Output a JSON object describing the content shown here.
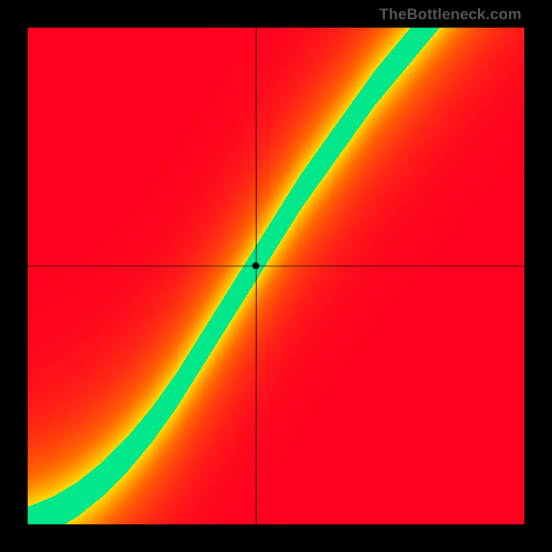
{
  "watermark": "TheBottleneck.com",
  "chart_data": {
    "type": "heatmap",
    "title": "",
    "xlabel": "",
    "ylabel": "",
    "xlim": [
      0,
      1
    ],
    "ylim": [
      0,
      1
    ],
    "crosshair": {
      "x": 0.46,
      "y": 0.52
    },
    "ridge": {
      "description": "optimal-balance curve; green band center y as function of x (normalized). Starts at origin, accelerates, then roughly linear slope ~1.3 after x≈0.35",
      "x": [
        0.0,
        0.05,
        0.1,
        0.15,
        0.2,
        0.25,
        0.3,
        0.35,
        0.4,
        0.45,
        0.5,
        0.55,
        0.6,
        0.65,
        0.7,
        0.75,
        0.8
      ],
      "y": [
        0.0,
        0.02,
        0.05,
        0.09,
        0.14,
        0.2,
        0.27,
        0.35,
        0.43,
        0.51,
        0.59,
        0.67,
        0.74,
        0.81,
        0.88,
        0.94,
        1.0
      ],
      "band_halfwidth": 0.035
    },
    "color_stops": {
      "description": "value 0→1 mapped red→orange→yellow→green; green at ridge",
      "stops": [
        {
          "v": 0.0,
          "color": "#ff0020"
        },
        {
          "v": 0.35,
          "color": "#ff6a00"
        },
        {
          "v": 0.65,
          "color": "#ffe800"
        },
        {
          "v": 0.85,
          "color": "#d8ff40"
        },
        {
          "v": 1.0,
          "color": "#00e88a"
        }
      ]
    },
    "grid_resolution": 140
  }
}
